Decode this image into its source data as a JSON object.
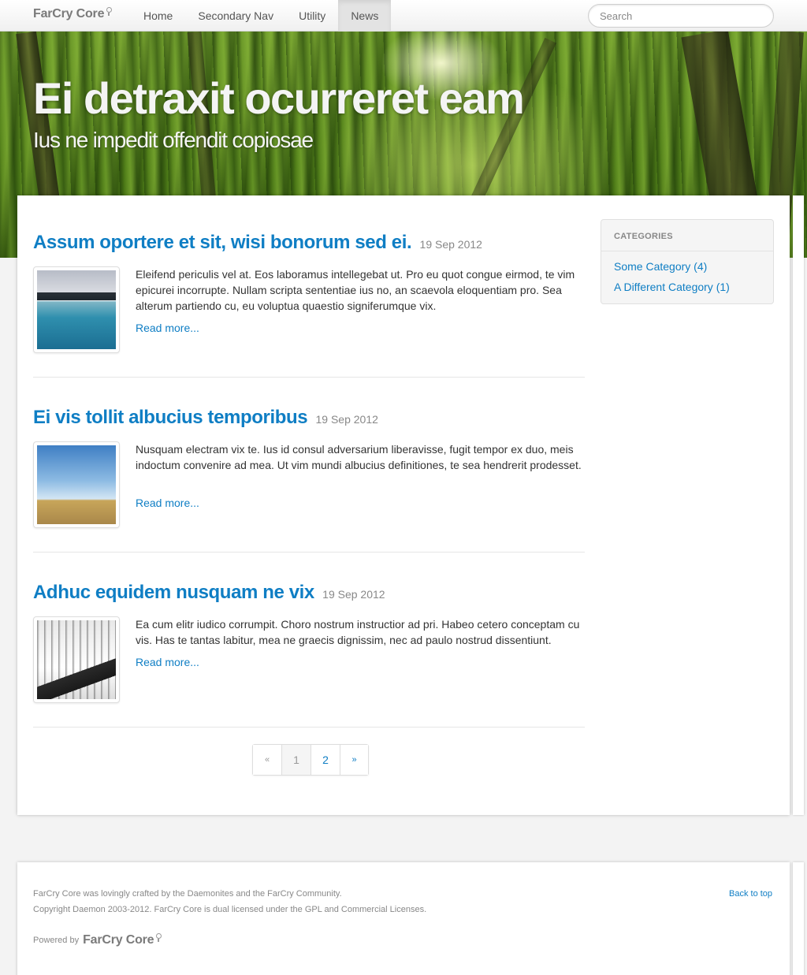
{
  "navbar": {
    "brand": "FarCry Core",
    "items": [
      {
        "label": "Home",
        "active": false
      },
      {
        "label": "Secondary Nav",
        "active": false
      },
      {
        "label": "Utility",
        "active": false
      },
      {
        "label": "News",
        "active": true
      }
    ],
    "search_placeholder": "Search"
  },
  "hero": {
    "title": "Ei detraxit ocurreret eam",
    "subtitle": "Ius ne impedit offendit copiosae"
  },
  "articles": [
    {
      "title": "Assum oportere et sit, wisi bonorum sed ei.",
      "date": "19 Sep 2012",
      "teaser": "Eleifend periculis vel at. Eos laboramus intellegebat ut. Pro eu quot congue eirmod, te vim epicurei incorrupte. Nullam scripta sententiae ius no, an scaevola eloquentiam pro. Sea alterum partiendo cu, eu voluptua quaestio signiferumque vix.",
      "read_more": "Read more...",
      "thumbnail": "city-skyline-water-image"
    },
    {
      "title": "Ei vis tollit albucius temporibus",
      "date": "19 Sep 2012",
      "teaser": "Nusquam electram vix te. Ius id consul adversarium liberavisse, fugit tempor ex duo, meis indoctum convenire ad mea. Ut vim mundi albucius definitiones, te sea hendrerit prodesset.",
      "read_more": "Read more...",
      "thumbnail": "wheat-field-sky-image"
    },
    {
      "title": "Adhuc equidem nusquam ne vix",
      "date": "19 Sep 2012",
      "teaser": "Ea cum elitr iudico corrumpit. Choro nostrum instructior ad pri. Habeo cetero conceptam cu vis. Has te tantas labitur, mea ne graecis dignissim, nec ad paulo nostrud dissentiunt.",
      "read_more": "Read more...",
      "thumbnail": "snowy-forest-road-image"
    }
  ],
  "sidebar": {
    "heading": "CATEGORIES",
    "categories": [
      {
        "label": "Some Category (4)"
      },
      {
        "label": "A Different Category (1)"
      }
    ]
  },
  "pagination": {
    "prev": "«",
    "pages": [
      "1",
      "2"
    ],
    "current": "1",
    "next": "»"
  },
  "footer": {
    "line1": "FarCry Core was lovingly crafted by the Daemonites and the FarCry Community.",
    "line2": "Copyright Daemon 2003-2012. FarCry Core is dual licensed under the GPL and Commercial Licenses.",
    "back_to_top": "Back to top",
    "powered_by": "Powered by",
    "powered_logo": "FarCry Core"
  },
  "colors": {
    "link": "#0f7ec4",
    "meta": "#888888",
    "hero_green": "#5a8a20"
  }
}
